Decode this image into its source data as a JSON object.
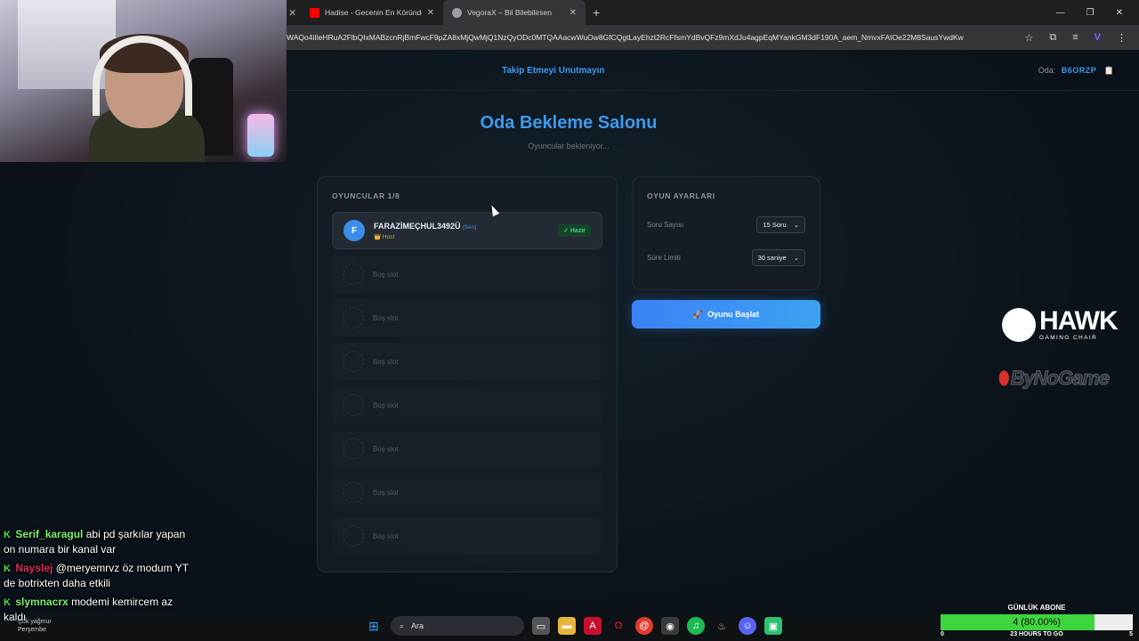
{
  "browser": {
    "tabs": [
      {
        "title": "Hadise - Gecenin En Köründe (",
        "favicon_color": "#ff0000"
      },
      {
        "title": "VegoraX – Bil Bilebilirsen",
        "favicon_color": "#9aa0a6"
      }
    ],
    "url": "WAQo4iIleHRuA2FlbQIxMABzcnRjBmFwcF9pZA8xMjQwMjQ1NzQyODc0MTQAAacwWuOw8GfCQgtLayEhzt2RcFfsmYdBvQFz9mXdJu4agpEqMYankGM3dF190A_aem_NmvxFAIOe22M8SausYwdKw"
  },
  "site": {
    "follow_text": "Takip Etmeyi Unutmayın",
    "room_label": "Oda:",
    "room_code": "B6ORZP",
    "title": "Oda Bekleme Salonu",
    "subtitle": "Oyuncular bekleniyor..."
  },
  "players_panel": {
    "title": "OYUNCULAR 1/8",
    "player": {
      "initial": "F",
      "name": "FARAZİMEÇHUL3492Ü",
      "you": "(Sen)",
      "role": "👑 Host",
      "status": "✓ Hazır"
    },
    "empty_slots": [
      "Boş slot",
      "Boş slot",
      "Boş slot",
      "Boş slot",
      "Boş slot",
      "Boş slot",
      "Boş slot"
    ]
  },
  "settings_panel": {
    "title": "OYUN AYARLARI",
    "question_count_label": "Soru Sayısı",
    "question_count_value": "15 Soru",
    "time_limit_label": "Süre Limiti",
    "time_limit_value": "30 saniye",
    "start_button": "Oyunu Başlat"
  },
  "chat": [
    {
      "user": "Serif_karagul",
      "text": "abi pd şarkılar yapan on numara bir kanal var"
    },
    {
      "user": "Nayslej",
      "text": "@meryemrvz öz modum YT de botrixten daha etkili"
    },
    {
      "user": "slymnacrx",
      "text": "modemi kemircem az kaldı"
    }
  ],
  "logos": {
    "hawk": "HAWK",
    "hawk_sub": "GAMING CHAIR",
    "bynogame": "ByNoGame"
  },
  "taskbar": {
    "search": "Ara",
    "weather_line1": "Çok yağmur",
    "weather_line2": "Perşembe"
  },
  "sub_goal": {
    "title": "GÜNLÜK ABONE",
    "value": "4 (80.00%)",
    "progress": 0.8,
    "min": "0",
    "max": "5",
    "countdown": "23 HOURS TO GO"
  },
  "colors": {
    "accent": "#3b9bf0",
    "ready": "#3fd17c",
    "host": "#e3a33b"
  }
}
